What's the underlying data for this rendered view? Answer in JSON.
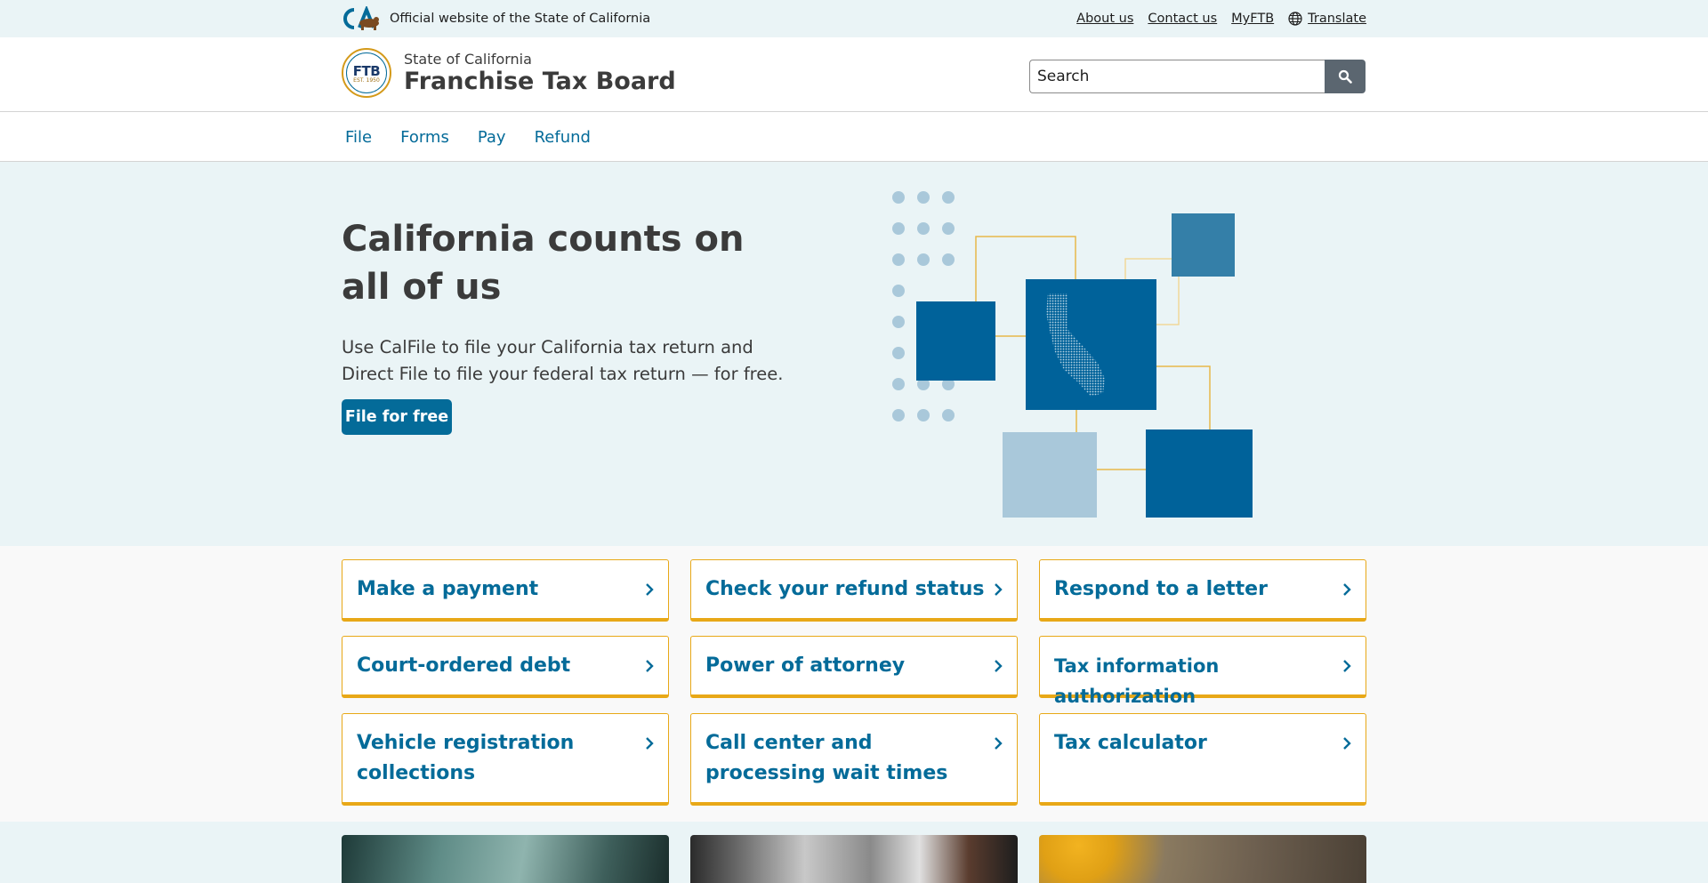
{
  "utility_bar": {
    "official_text": "Official website of the State of California",
    "links": {
      "about": "About us",
      "contact": "Contact us",
      "myftb": "MyFTB",
      "translate": "Translate"
    }
  },
  "header": {
    "agency_parent": "State of California",
    "agency_name": "Franchise Tax Board",
    "seal_text": "FTB",
    "seal_est": "EST. 1950",
    "search_placeholder": "Search"
  },
  "nav": {
    "items": [
      "File",
      "Forms",
      "Pay",
      "Refund"
    ]
  },
  "hero": {
    "title": "California counts on all of us",
    "text": "Use CalFile to file your California tax return and Direct File to file your federal tax return — for free.",
    "button": "File for free"
  },
  "cards": [
    "Make a payment",
    "Check your refund status",
    "Respond to a letter",
    "Court-ordered debt",
    "Power of attorney",
    "Tax information authorization",
    "Vehicle registration collections",
    "Call center and processing wait times",
    "Tax calculator"
  ],
  "colors": {
    "accent": "#046b99",
    "gold": "#e8a817",
    "hero_bg": "#eaf4f6",
    "dark_square": "#00629a",
    "mid_square": "#347fa8",
    "light_square": "#a9c8da"
  }
}
